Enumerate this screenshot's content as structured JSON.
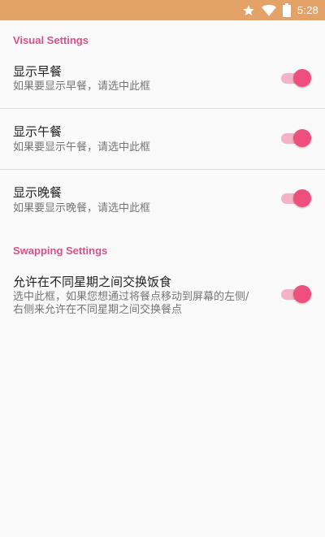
{
  "status_bar": {
    "time": "5:28",
    "icons": [
      "star-icon",
      "wifi-icon",
      "battery-icon"
    ],
    "background": "#e3a267"
  },
  "theme": {
    "accent": "#ef4f7f",
    "section_header_color": "#d6518a"
  },
  "sections": {
    "visual": {
      "header": "Visual Settings",
      "items": [
        {
          "title": "显示早餐",
          "summary": "如果要显示早餐，请选中此框",
          "checked": true
        },
        {
          "title": "显示午餐",
          "summary": "如果要显示午餐，请选中此框",
          "checked": true
        },
        {
          "title": "显示晚餐",
          "summary": "如果要显示晚餐，请选中此框",
          "checked": true
        }
      ]
    },
    "swapping": {
      "header": "Swapping Settings",
      "items": [
        {
          "title": "允许在不同星期之间交换饭食",
          "summary": "选中此框，如果您想通过将餐点移动到屏幕的左侧/右侧来允许在不同星期之间交换餐点",
          "checked": true
        }
      ]
    }
  }
}
